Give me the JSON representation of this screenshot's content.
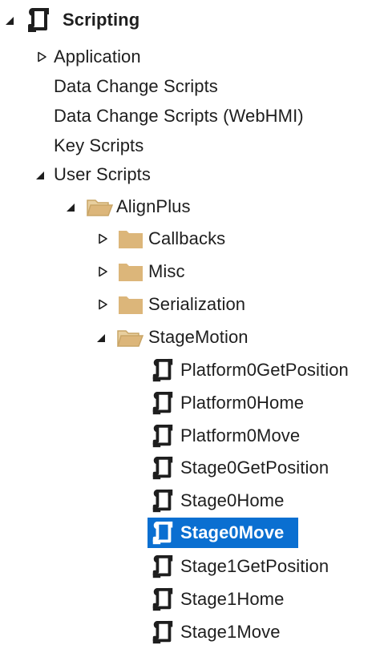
{
  "tree": {
    "root": {
      "label": "Scripting",
      "icon": "script-icon",
      "expanded": true
    },
    "items": [
      {
        "key": "application",
        "label": "Application",
        "toggle": "collapsed",
        "icon": null
      },
      {
        "key": "data_change_scripts",
        "label": "Data Change Scripts",
        "toggle": null,
        "icon": null
      },
      {
        "key": "data_change_scripts_webhmi",
        "label": "Data Change Scripts (WebHMI)",
        "toggle": null,
        "icon": null
      },
      {
        "key": "key_scripts",
        "label": "Key Scripts",
        "toggle": null,
        "icon": null
      },
      {
        "key": "user_scripts",
        "label": "User Scripts",
        "toggle": "expanded",
        "icon": null
      },
      {
        "key": "alignplus",
        "label": "AlignPlus",
        "toggle": "expanded",
        "icon": "open-folder-icon"
      },
      {
        "key": "callbacks",
        "label": "Callbacks",
        "toggle": "collapsed",
        "icon": "folder-icon"
      },
      {
        "key": "misc",
        "label": "Misc",
        "toggle": "collapsed",
        "icon": "folder-icon"
      },
      {
        "key": "serialization",
        "label": "Serialization",
        "toggle": "collapsed",
        "icon": "folder-icon"
      },
      {
        "key": "stagemotion",
        "label": "StageMotion",
        "toggle": "expanded",
        "icon": "open-folder-icon"
      },
      {
        "key": "platform0getposition",
        "label": "Platform0GetPosition",
        "toggle": null,
        "icon": "script-icon"
      },
      {
        "key": "platform0home",
        "label": "Platform0Home",
        "toggle": null,
        "icon": "script-icon"
      },
      {
        "key": "platform0move",
        "label": "Platform0Move",
        "toggle": null,
        "icon": "script-icon"
      },
      {
        "key": "stage0getposition",
        "label": "Stage0GetPosition",
        "toggle": null,
        "icon": "script-icon"
      },
      {
        "key": "stage0home",
        "label": "Stage0Home",
        "toggle": null,
        "icon": "script-icon"
      },
      {
        "key": "stage0move",
        "label": "Stage0Move",
        "toggle": null,
        "icon": "script-icon",
        "selected": true
      },
      {
        "key": "stage1getposition",
        "label": "Stage1GetPosition",
        "toggle": null,
        "icon": "script-icon"
      },
      {
        "key": "stage1home",
        "label": "Stage1Home",
        "toggle": null,
        "icon": "script-icon"
      },
      {
        "key": "stage1move",
        "label": "Stage1Move",
        "toggle": null,
        "icon": "script-icon"
      }
    ]
  },
  "colors": {
    "selection": "#0a6fd1",
    "folder": "#dcb67a",
    "text": "#1e1e1e",
    "icon_dark": "#1e1e1e"
  }
}
